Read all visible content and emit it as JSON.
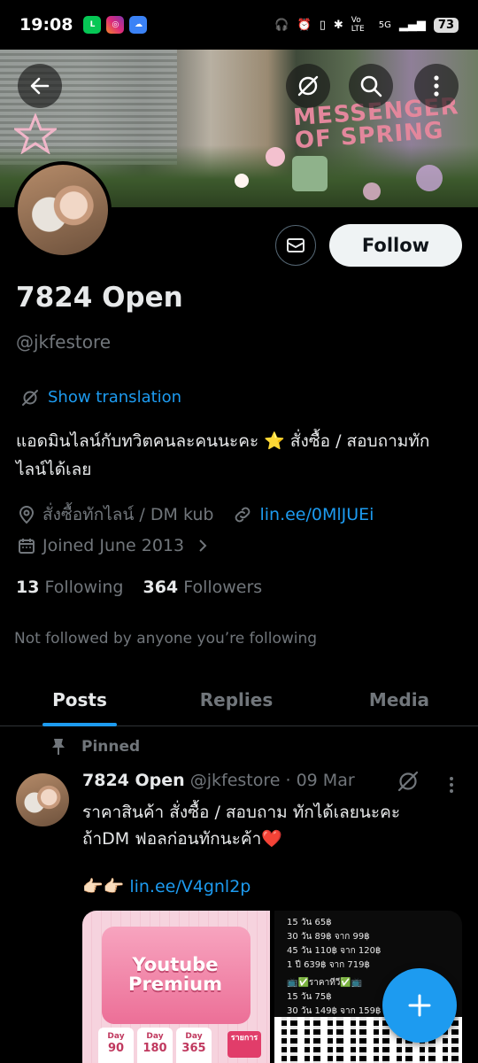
{
  "status_bar": {
    "time": "19:08",
    "battery": "73",
    "network_label": "5G",
    "volte_label": "Vo LTE"
  },
  "banner": {
    "graffiti_text": "MESSENGER OF SPRING"
  },
  "profile": {
    "display_name": "7824 Open",
    "handle": "@jkfestore",
    "follow_label": "Follow",
    "translate_label": "Show translation",
    "bio": "แอดมินไลน์กับทวิตคนละคนนะคะ ⭐ สั่งซื้อ / สอบถามทักไลน์ได้เลย",
    "location": "สั่งซื้อทักไลน์ / DM kub",
    "website": "lin.ee/0MlJUEi",
    "joined": "Joined June 2013",
    "following_count": "13",
    "following_label": "Following",
    "followers_count": "364",
    "followers_label": "Followers",
    "not_followed_note": "Not followed by anyone you’re following"
  },
  "tabs": [
    {
      "label": "Posts",
      "active": true
    },
    {
      "label": "Replies",
      "active": false
    },
    {
      "label": "Media",
      "active": false
    }
  ],
  "pinned_post": {
    "pinned_label": "Pinned",
    "author_name": "7824 Open",
    "author_handle": "@jkfestore",
    "separator": "·",
    "date": "09 Mar",
    "text_line1": "ราคาสินค้า สั่งซื้อ / สอบถาม ทักได้เลยนะคะ",
    "text_line2": "ถ้าDM ฟอลก่อนทักนะค้า❤️",
    "link_prefix": "👉🏻👉🏻",
    "link": "lin.ee/V4gnl2p",
    "media1": {
      "title": "Youtube Premium",
      "days": [
        {
          "label": "Day",
          "value": "90"
        },
        {
          "label": "Day",
          "value": "180"
        },
        {
          "label": "Day",
          "value": "365"
        }
      ],
      "ribbon": "รายการ"
    },
    "media2": {
      "lines": [
        "15 วัน 65฿",
        "30 วัน 89฿ จาก 99฿",
        "45 วัน 110฿ จาก 120฿",
        "1 ปี 639฿ จาก 719฿",
        "📺✅ราคาทีวี✅📺",
        "15 วัน 75฿",
        "30 วัน 149฿ จาก 159฿"
      ]
    }
  },
  "icons": {
    "back": "arrow-left-icon",
    "grok": "grok-icon",
    "search": "search-icon",
    "more": "more-vertical-icon",
    "message": "envelope-icon",
    "location": "location-pin-icon",
    "link": "link-icon",
    "calendar": "calendar-icon",
    "pin": "pin-icon",
    "compose": "plus-icon"
  },
  "colors": {
    "accent": "#1d9bf0",
    "text_primary": "#e7e9ea",
    "text_secondary": "#71767b",
    "background": "#000000"
  }
}
